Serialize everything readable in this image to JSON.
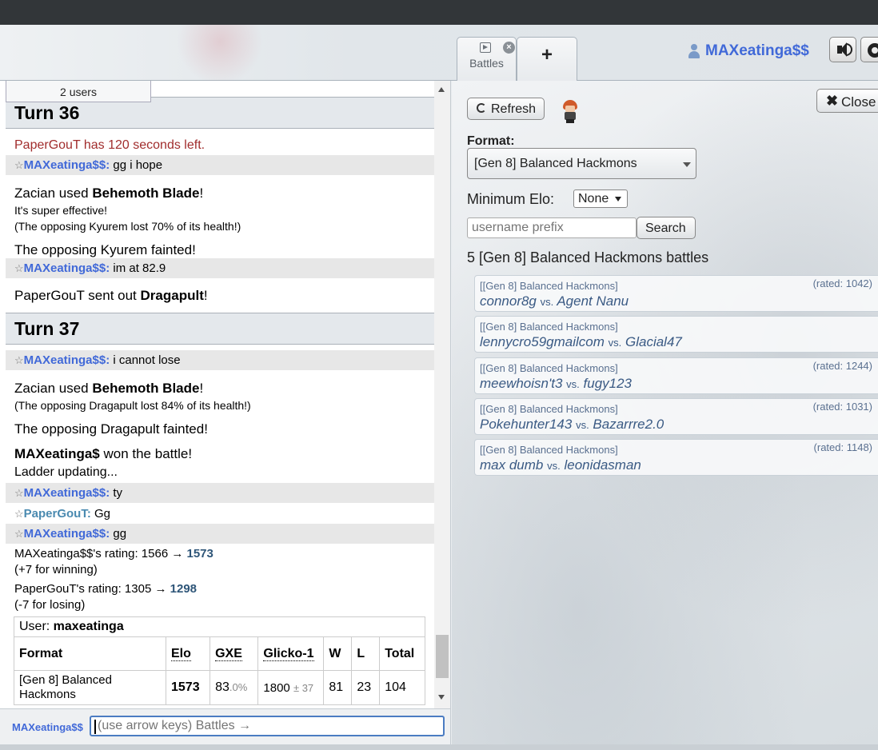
{
  "header": {
    "tabs": [
      {
        "label": "Battles"
      },
      {
        "label": "+"
      }
    ],
    "username": "MAXeatinga$$"
  },
  "chat": {
    "users_count": "2 users",
    "turn36": "Turn 36",
    "timer": "PaperGouT has 120 seconds left.",
    "msg1": {
      "nick": "MAXeatinga$$:",
      "text": "gg i hope"
    },
    "zacian1": {
      "pre": "Zacian used ",
      "move": "Behemoth Blade",
      "post": "!"
    },
    "super_effective": "It's super effective!",
    "kyurem_damage": "(The opposing Kyurem lost 70% of its health!)",
    "kyurem_faint": "The opposing Kyurem fainted!",
    "msg2": {
      "nick": "MAXeatinga$$:",
      "text": "im at 82.9"
    },
    "sendout": {
      "pre": "PaperGouT sent out ",
      "mon": "Dragapult",
      "post": "!"
    },
    "turn37": "Turn 37",
    "msg3": {
      "nick": "MAXeatinga$$:",
      "text": "i cannot lose"
    },
    "zacian2": {
      "pre": "Zacian used ",
      "move": "Behemoth Blade",
      "post": "!"
    },
    "dragapult_damage": "(The opposing Dragapult lost 84% of its health!)",
    "dragapult_faint": "The opposing Dragapult fainted!",
    "winner": {
      "name": "MAXeatinga$",
      "text": " won the battle!"
    },
    "ladder_updating": "Ladder updating...",
    "msg4": {
      "nick": "MAXeatinga$$:",
      "text": "ty"
    },
    "msg5": {
      "nick": "PaperGouT:",
      "text": "Gg"
    },
    "msg6": {
      "nick": "MAXeatinga$$:",
      "text": "gg"
    },
    "rating1": {
      "pre": "MAXeatinga$$'s rating: 1566 → ",
      "new": "1573",
      "delta": "(+7 for winning)"
    },
    "rating2": {
      "pre": "PaperGouT's rating: 1305 → ",
      "new": "1298",
      "delta": "(-7 for losing)"
    },
    "ladder_table": {
      "user_label": "User: ",
      "user": "maxeatinga",
      "headers": [
        "Format",
        "Elo",
        "GXE",
        "Glicko-1",
        "W",
        "L",
        "Total"
      ],
      "row": {
        "format": "[Gen 8] Balanced Hackmons",
        "elo": "1573",
        "gxe": "83",
        "gxe_frac": ".0%",
        "glicko": "1800",
        "glicko_dev": "± 37",
        "w": "81",
        "l": "23",
        "total": "104"
      }
    },
    "input_nick": "MAXeatinga$$",
    "input_placeholder": "(use arrow keys) Battles →"
  },
  "battles_panel": {
    "refresh": "Refresh",
    "close": "Close",
    "format_label": "Format:",
    "format_value": "[Gen 8] Balanced Hackmons",
    "min_elo_label": "Minimum Elo:",
    "min_elo_value": "None",
    "prefix_placeholder": "username prefix",
    "search": "Search",
    "title": "5 [Gen 8] Balanced Hackmons battles",
    "battles": [
      {
        "format": "[[Gen 8] Balanced Hackmons]",
        "rated": "(rated: 1042)",
        "p1": "connor8g",
        "vs": "vs.",
        "p2": "Agent Nanu"
      },
      {
        "format": "[[Gen 8] Balanced Hackmons]",
        "rated": "",
        "p1": "lennycro59gmailcom",
        "vs": "vs.",
        "p2": "Glacial47"
      },
      {
        "format": "[[Gen 8] Balanced Hackmons]",
        "rated": "(rated: 1244)",
        "p1": "meewhoisn't3",
        "vs": "vs.",
        "p2": "fugy123"
      },
      {
        "format": "[[Gen 8] Balanced Hackmons]",
        "rated": "(rated: 1031)",
        "p1": "Pokehunter143",
        "vs": "vs.",
        "p2": "Bazarrre2.0"
      },
      {
        "format": "[[Gen 8] Balanced Hackmons]",
        "rated": "(rated: 1148)",
        "p1": "max dumb",
        "vs": "vs.",
        "p2": "leonidasman"
      }
    ]
  }
}
